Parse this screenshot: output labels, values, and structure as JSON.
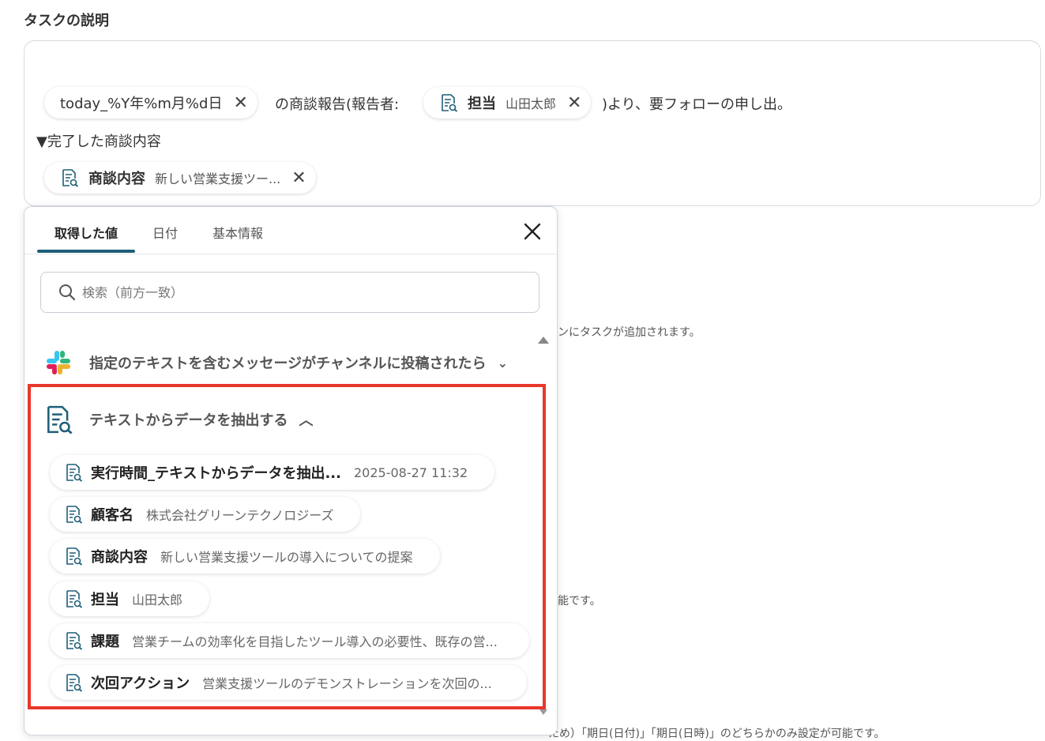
{
  "section_title": "タスクの説明",
  "description": {
    "date_pill": "today_%Y年%m月%d日",
    "text_after_date": "の商談報告(報告者:",
    "assignee_label": "担当",
    "assignee_value": "山田太郎",
    "text_after_assignee": ")より、要フォローの申し出。",
    "line2": "▼完了した商談内容",
    "deal_label": "商談内容",
    "deal_value": "新しい営業支援ツー..."
  },
  "background_hints": {
    "hint1": "ンにタスクが追加されます。",
    "hint2": "能です。",
    "hint3": "ため）「期日(日付)」「期日(日時)」のどちらかのみ設定が可能です。"
  },
  "popover": {
    "tabs": [
      "取得した値",
      "日付",
      "基本情報"
    ],
    "search_placeholder": "検索（前方一致）",
    "group1_title": "指定のテキストを含むメッセージがチャンネルに投稿されたら",
    "group2_title": "テキストからデータを抽出する",
    "items": [
      {
        "label": "実行時間_テキストからデータを抽出...",
        "value": "2025-08-27 11:32"
      },
      {
        "label": "顧客名",
        "value": "株式会社グリーンテクノロジーズ"
      },
      {
        "label": "商談内容",
        "value": "新しい営業支援ツールの導入についての提案"
      },
      {
        "label": "担当",
        "value": "山田太郎"
      },
      {
        "label": "課題",
        "value": "営業チームの効率化を目指したツール導入の必要性、既存の営..."
      },
      {
        "label": "次回アクション",
        "value": "営業支援ツールのデモンストレーションを次回の..."
      }
    ]
  },
  "colors": {
    "highlight": "#e8372b",
    "tab_underline": "#1f5f7a",
    "icon_teal": "#1f5f7a"
  }
}
